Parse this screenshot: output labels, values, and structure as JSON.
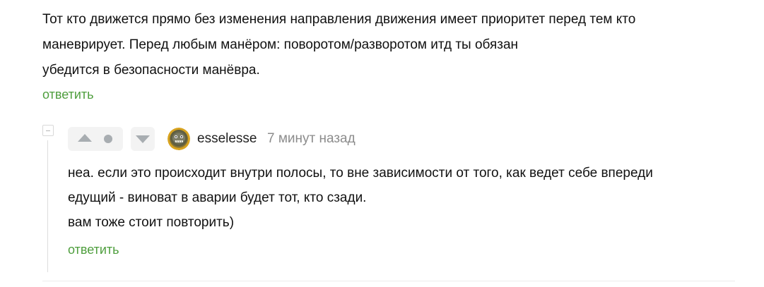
{
  "parent_comment": {
    "lines": [
      "Тот кто движется прямо без изменения направления движения имеет приоритет перед тем кто",
      "маневрирует. Перед любым манёром: поворотом/разворотом итд ты обязан",
      "убедится в безопасности манёвра."
    ],
    "reply_label": "ответить"
  },
  "reply_comment": {
    "username": "esselesse",
    "timestamp": "7 минут назад",
    "lines": [
      "неа. если это происходит внутри полосы, то вне зависимости от того, как ведет себе впереди",
      "едущий - виноват в аварии будет тот, кто сзади.",
      "вам тоже стоит повторить)"
    ],
    "reply_label": "ответить"
  },
  "icons": {
    "collapse": "collapse-minus-icon",
    "upvote": "arrow-up-icon",
    "rating": "rating-dot-icon",
    "downvote": "arrow-down-icon"
  },
  "colors": {
    "reply_link": "#4e9e3d",
    "muted_text": "#8c8c8c",
    "vote_bg": "#f3f3f3",
    "vote_icon": "#a8adb1"
  }
}
